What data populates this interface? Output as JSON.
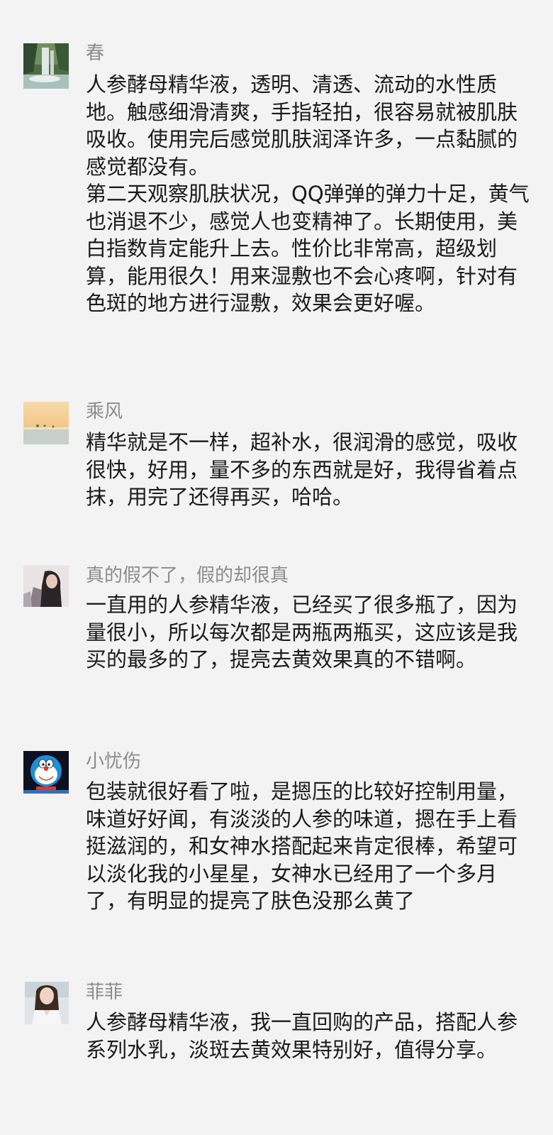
{
  "comments": [
    {
      "nickname": "春",
      "avatar": "waterfall-forest-avatar",
      "content": "人参酵母精华液，透明、清透、流动的水性质地。触感细滑清爽，手指轻拍，很容易就被肌肤吸收。使用完后感觉肌肤润泽许多，一点黏腻的感觉都没有。\n第二天观察肌肤状况，QQ弹弹的弹力十足，黄气也消退不少，感觉人也变精神了。长期使用，美白指数肯定能升上去。性价比非常高，超级划算，能用很久！用来湿敷也不会心疼啊，针对有色斑的地方进行湿敷，效果会更好喔。"
    },
    {
      "nickname": "乘风",
      "avatar": "sunset-sea-avatar",
      "content": "精华就是不一样，超补水，很润滑的感觉，吸收很快，好用，量不多的东西就是好，我得省着点抹，用完了还得再买，哈哈。"
    },
    {
      "nickname": "真的假不了，假的却很真",
      "avatar": "girl-portrait-avatar",
      "content": "一直用的人参精华液，已经买了很多瓶了，因为量很小，所以每次都是两瓶两瓶买，这应该是我买的最多的了，提亮去黄效果真的不错啊。"
    },
    {
      "nickname": "小忧伤",
      "avatar": "doraemon-avatar",
      "content": "包装就很好看了啦，是摁压的比较好控制用量，味道好好闻，有淡淡的人参的味道，摁在手上看挺滋润的，和女神水搭配起来肯定很棒，希望可以淡化我的小星星，女神水已经用了一个多月了，有明显的提亮了肤色没那么黄了"
    },
    {
      "nickname": "菲菲",
      "avatar": "woman-portrait-avatar",
      "content": "人参酵母精华液，我一直回购的产品，搭配人参系列水乳，淡斑去黄效果特别好，值得分享。"
    }
  ]
}
